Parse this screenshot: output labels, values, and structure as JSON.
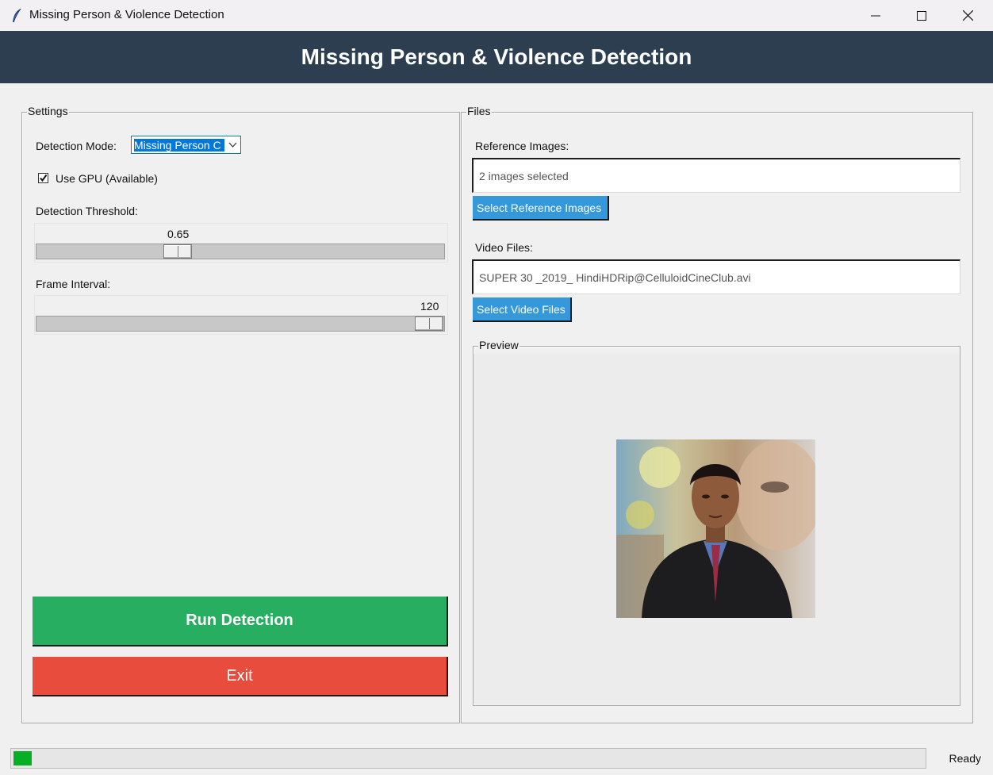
{
  "window": {
    "title": "Missing Person & Violence Detection",
    "icon": "feather-icon"
  },
  "header": {
    "title": "Missing Person & Violence Detection",
    "bg_color": "#2c3e50"
  },
  "settings": {
    "legend": "Settings",
    "detection_mode_label": "Detection Mode:",
    "detection_mode_value": "Missing Person C",
    "use_gpu_label": "Use GPU (Available)",
    "use_gpu_checked": true,
    "threshold_label": "Detection Threshold:",
    "threshold_value": "0.65",
    "frame_interval_label": "Frame Interval:",
    "frame_interval_value": "120",
    "run_label": "Run Detection",
    "exit_label": "Exit",
    "run_color": "#27ae60",
    "exit_color": "#e74c3c"
  },
  "files": {
    "legend": "Files",
    "ref_label": "Reference Images:",
    "ref_value": "2 images selected",
    "ref_button": "Select Reference Images",
    "video_label": "Video Files:",
    "video_value": "SUPER 30 _2019_ HindiHDRip@CelluloidCineClub.avi",
    "video_button": "Select Video Files",
    "button_color": "#3498db",
    "preview_legend": "Preview"
  },
  "status": {
    "text": "Ready",
    "progress_fraction": 0.02,
    "progress_color": "#06b025"
  }
}
